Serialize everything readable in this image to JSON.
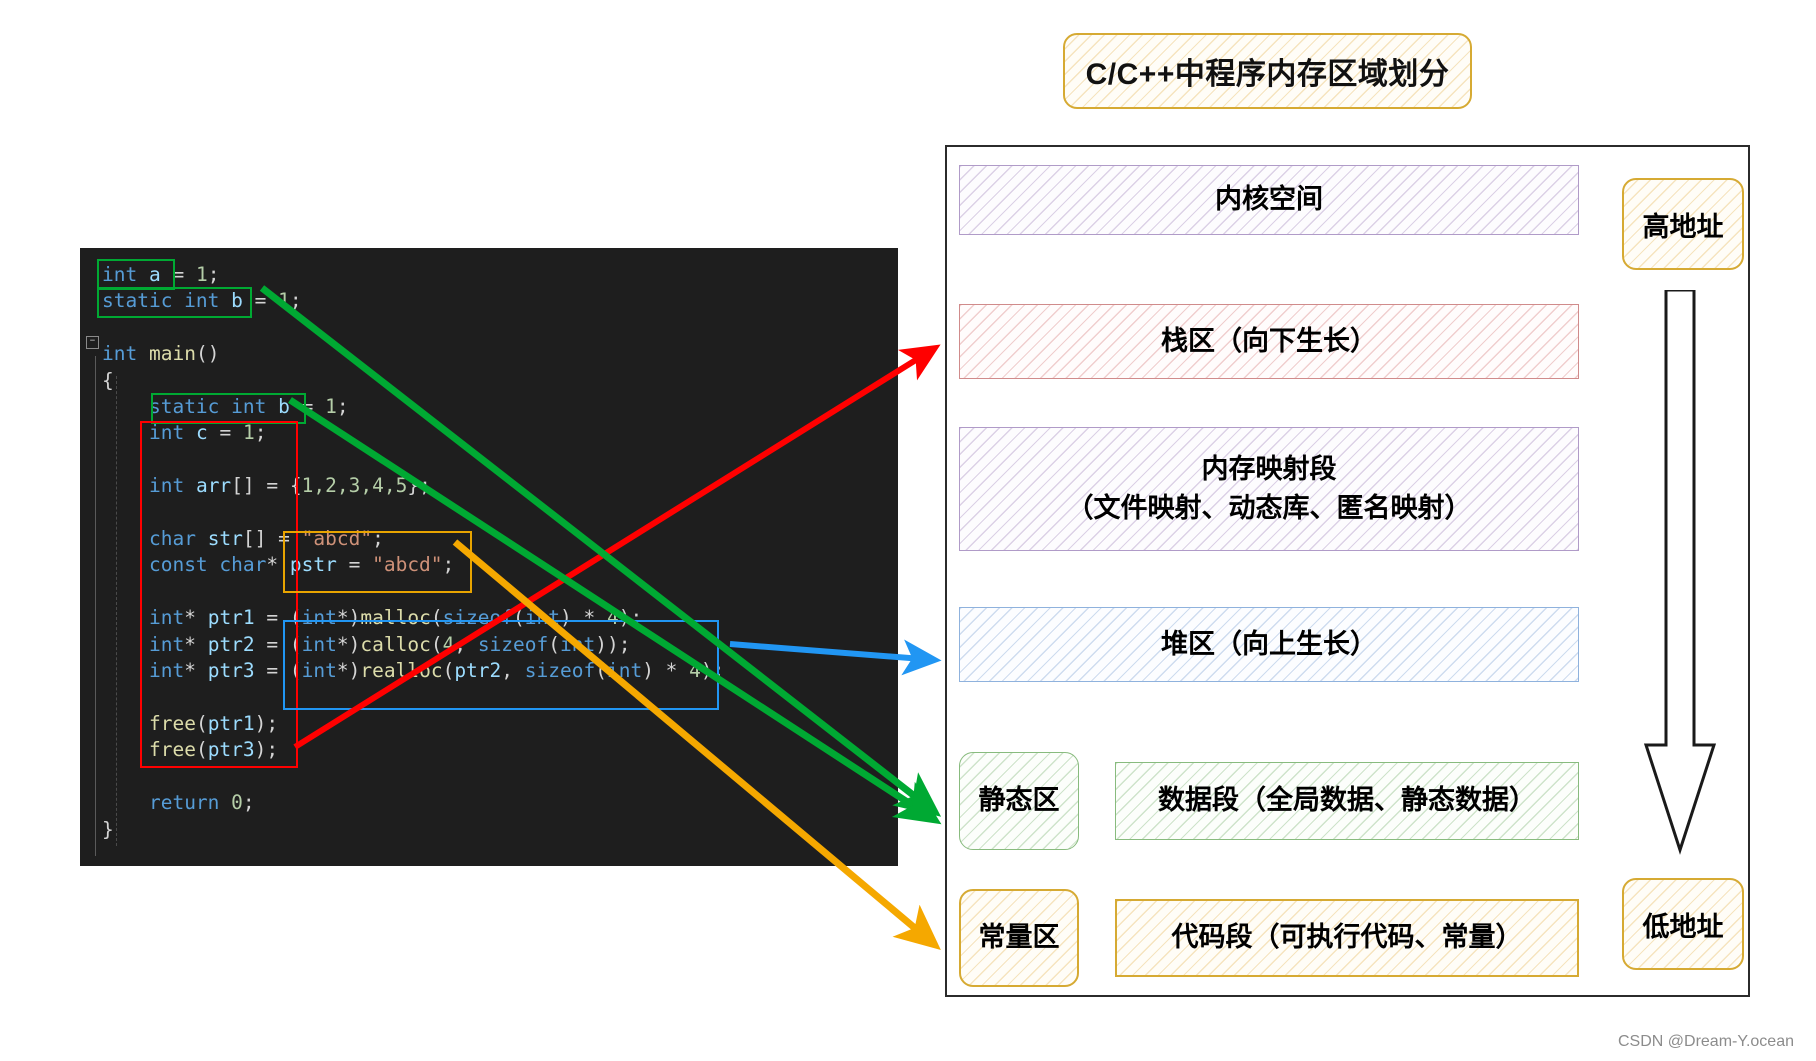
{
  "title": {
    "text": "C/C++中程序内存区域划分"
  },
  "code": {
    "lines": [
      "int a = 1;",
      "static int b = 1;",
      "",
      "int main()",
      "{",
      "    static int b = 1;",
      "    int c = 1;",
      "",
      "    int arr[] = {1,2,3,4,5};",
      "",
      "    char str[] = \"abcd\";",
      "    const char* pstr = \"abcd\";",
      "",
      "    int* ptr1 = (int*)malloc(sizeof(int) * 4);",
      "    int* ptr2 = (int*)calloc(4, sizeof(int));",
      "    int* ptr3 = (int*)realloc(ptr2, sizeof(int) * 4);",
      "",
      "    free(ptr1);",
      "    free(ptr3);",
      "",
      "    return 0;",
      "}"
    ],
    "collapse_glyph": "−",
    "highlights": [
      {
        "name": "int-a-declaration",
        "color": "#00a933"
      },
      {
        "name": "static-int-b-global",
        "color": "#00a933"
      },
      {
        "name": "static-int-b-local",
        "color": "#00a933"
      },
      {
        "name": "stack-locals-block",
        "color": "#ff0000"
      },
      {
        "name": "string-literal-block",
        "color": "#e8a400"
      },
      {
        "name": "heap-alloc-block",
        "color": "#2196f3"
      }
    ]
  },
  "diagram": {
    "regions": [
      {
        "id": "kernel",
        "label": "内核空间",
        "style": "hatch-purple"
      },
      {
        "id": "stack",
        "label": "栈区（向下生长）",
        "style": "hatch-red"
      },
      {
        "id": "mmap",
        "label_line1": "内存映射段",
        "label_line2": "（文件映射、动态库、匿名映射）",
        "style": "hatch-purple"
      },
      {
        "id": "heap",
        "label": "堆区（向上生长）",
        "style": "hatch-blue"
      }
    ],
    "static_tag": "静态区",
    "data_segment": "数据段（全局数据、静态数据）",
    "const_tag": "常量区",
    "code_segment": "代码段（可执行代码、常量）",
    "high_address": "高地址",
    "low_address": "低地址"
  },
  "arrows": [
    {
      "name": "stack-arrow",
      "color": "#ff0000",
      "from": "free(ptr3) area",
      "to": "栈区（向下生长）"
    },
    {
      "name": "heap-arrow",
      "color": "#2196f3",
      "from": "heap-alloc-block",
      "to": "堆区（向上生长）"
    },
    {
      "name": "static-arrow-1",
      "color": "#00a933",
      "from": "static int b = 1; (global)",
      "to": "静态区"
    },
    {
      "name": "static-arrow-2",
      "color": "#00a933",
      "from": "static int b = 1; (local)",
      "to": "静态区"
    },
    {
      "name": "const-arrow",
      "color": "#f5a800",
      "from": "\"abcd\" literal",
      "to": "常量区"
    }
  ],
  "watermark": "CSDN @Dream-Y.ocean",
  "colors": {
    "editor_bg": "#1e1e1e",
    "green": "#00a933",
    "red": "#ff0000",
    "orange": "#e8a400",
    "blue": "#2196f3",
    "gold": "#f5a800",
    "purple_border": "#b09bc8",
    "red_border": "#d08b8b",
    "blue_border": "#8fb2dd",
    "green_border": "#88bb7e",
    "gold_border": "#d6aa33"
  }
}
